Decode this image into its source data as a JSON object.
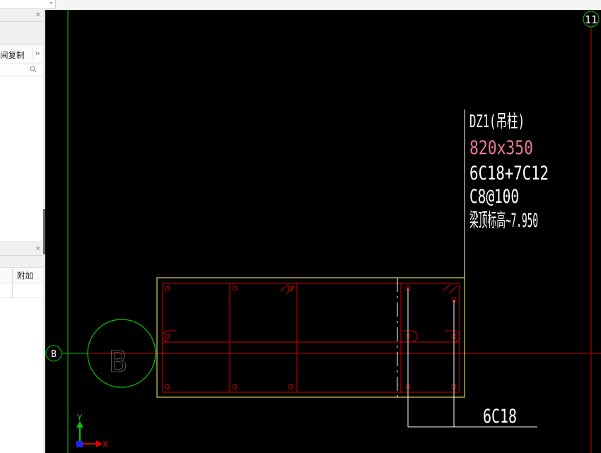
{
  "toolbar": {
    "dropdown_arrow": "⌄"
  },
  "panel_top": {
    "close": "×",
    "copy_label": "间复制",
    "more": "››"
  },
  "panel_bottom": {
    "close": "×",
    "column_attach": "附加"
  },
  "drawing": {
    "axis_b": "B",
    "axis_b_large": "B",
    "axis_11": "11",
    "column_name": "DZ1(吊柱)",
    "column_size": "820x350",
    "rebar_main": "6C18+7C12",
    "stirrup": "C8@100",
    "elevation": "梁顶标高~7.950",
    "rebar_callout": "6C18",
    "ucs_y": "Y",
    "ucs_x": "X"
  },
  "colors": {
    "canvas_bg": "#000000",
    "axis_green": "#00c800",
    "grid_red": "#d20000",
    "outline_yellow": "#ffff66",
    "text_white": "#ffffff",
    "text_pink": "#e87896",
    "ucs_blue": "#2020ff"
  }
}
